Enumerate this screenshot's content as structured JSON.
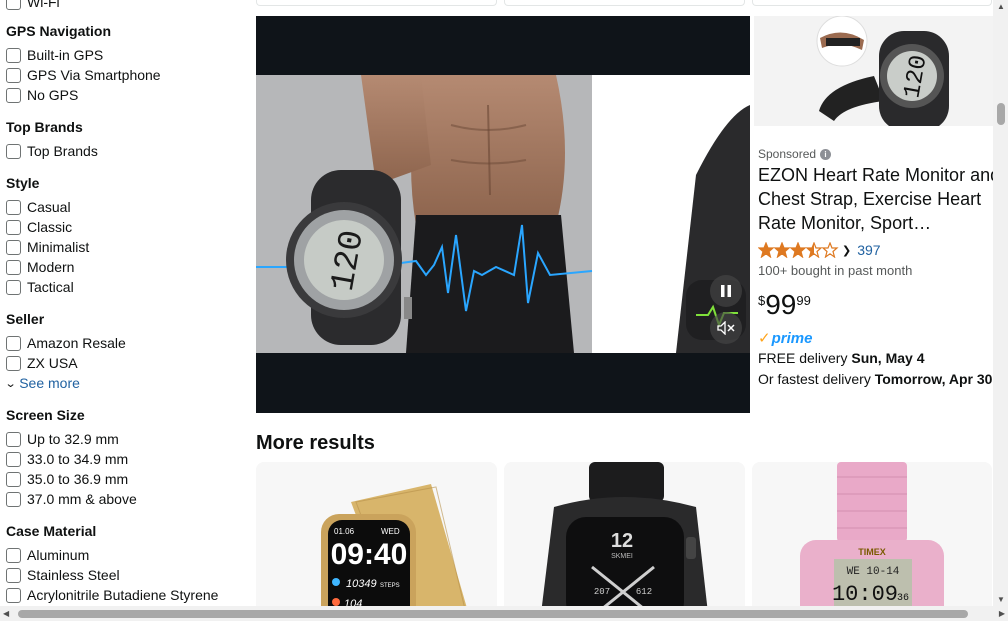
{
  "sidebar": {
    "wifi_label": "Wi-Fi",
    "sections": [
      {
        "title": "GPS Navigation",
        "options": [
          "Built-in GPS",
          "GPS Via Smartphone",
          "No GPS"
        ]
      },
      {
        "title": "Top Brands",
        "options": [
          "Top Brands"
        ]
      },
      {
        "title": "Style",
        "options": [
          "Casual",
          "Classic",
          "Minimalist",
          "Modern",
          "Tactical"
        ]
      },
      {
        "title": "Seller",
        "options": [
          "Amazon Resale",
          "ZX USA"
        ],
        "see_more": "See more"
      },
      {
        "title": "Screen Size",
        "options": [
          "Up to 32.9 mm",
          "33.0 to 34.9 mm",
          "35.0 to 36.9 mm",
          "37.0 mm & above"
        ]
      },
      {
        "title": "Case Material",
        "options": [
          "Aluminum",
          "Stainless Steel",
          "Acrylonitrile Butadiene Styrene"
        ]
      }
    ]
  },
  "video_ad": {
    "watch_display": "120",
    "pause_icon": "pause-icon",
    "mute_icon": "muted-speaker-icon"
  },
  "sponsored": {
    "label": "Sponsored",
    "info_glyph": "i",
    "title": "EZON Heart Rate Monitor and Chest Strap, Exercise Heart Rate Monitor, Sport…",
    "rating": 3.5,
    "rating_count": "397",
    "bought": "100+ bought in past month",
    "price_symbol": "$",
    "price_whole": "99",
    "price_fraction": "99",
    "prime": "prime",
    "delivery_prefix": "FREE delivery ",
    "delivery_date": "Sun, May 4",
    "fast_prefix": "Or fastest delivery ",
    "fast_date": "Tomorrow, Apr 30",
    "thumb_display": "120",
    "colors": {
      "star": "#de7921",
      "link": "#2162a1",
      "prime": "#1a98ff"
    }
  },
  "more_results": {
    "title": "More results",
    "cards": [
      {
        "watch_time": "09:40",
        "watch_date": "01.06",
        "watch_day": "WED",
        "steps": "10349",
        "steps_label": "STEPS",
        "hr": "104"
      },
      {
        "digit": "12",
        "brand": "SKMEI",
        "left_sub": "207",
        "right_sub": "612"
      },
      {
        "brand": "TIMEX",
        "display_top": "WE 10-14",
        "display_main": "10:09",
        "display_sec": "36"
      }
    ]
  }
}
